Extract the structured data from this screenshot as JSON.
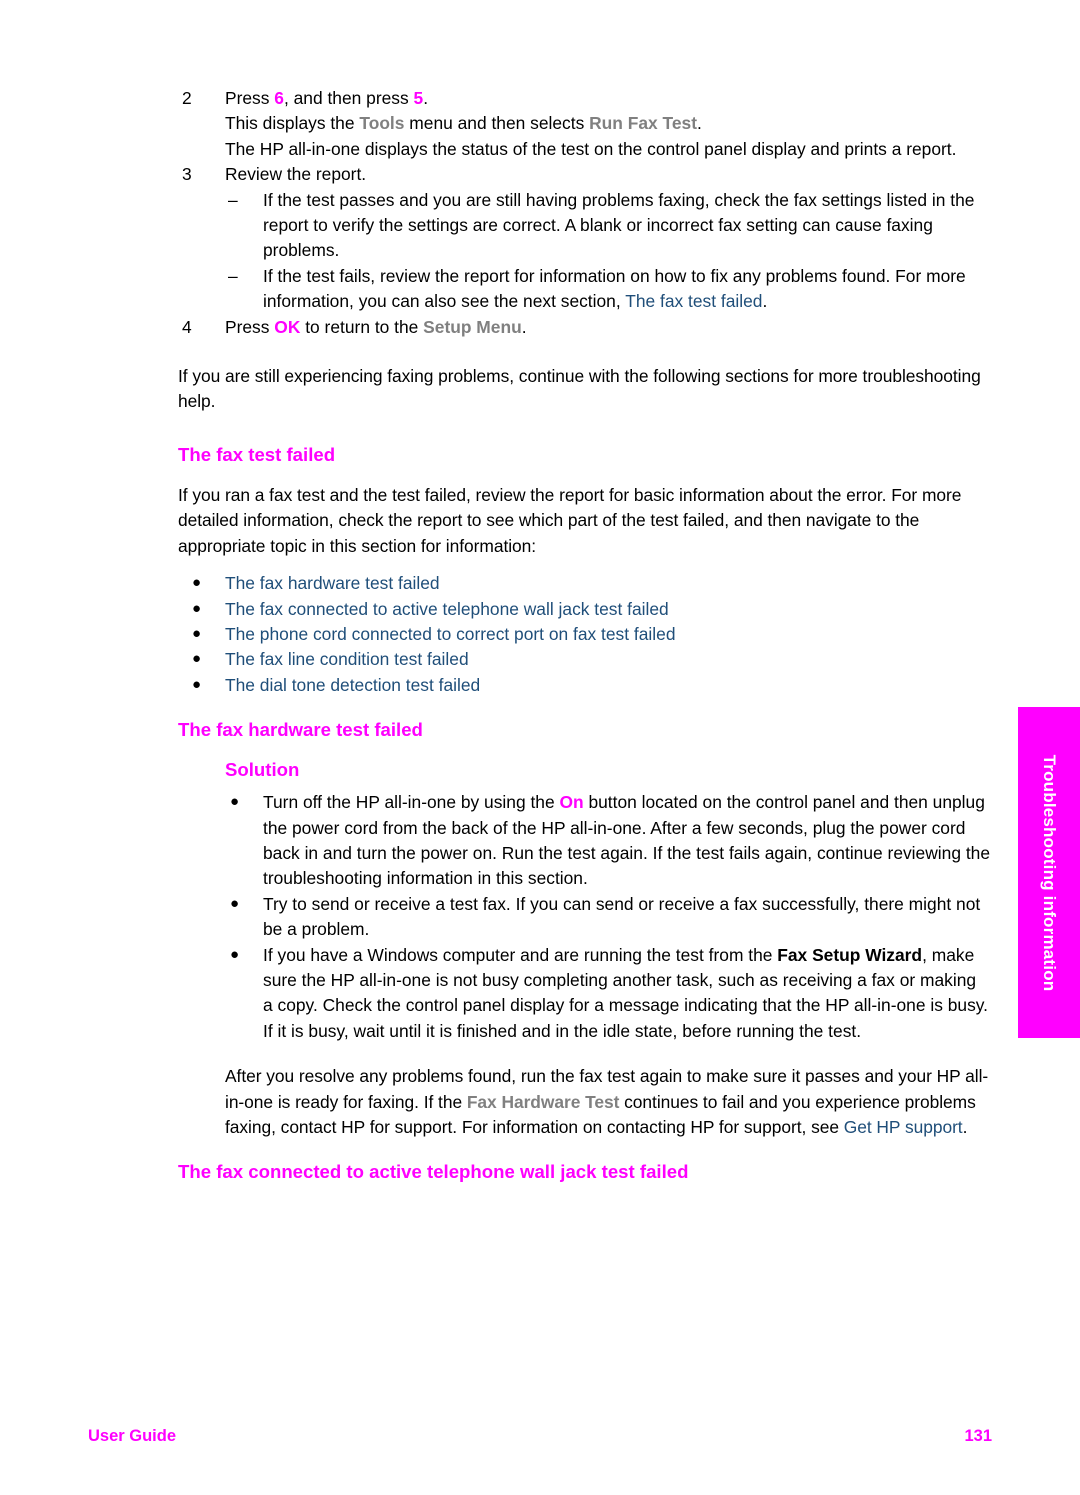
{
  "document": {
    "type": "user-guide-page",
    "colors": {
      "heading_magenta": "#ff00ff",
      "link_navy": "#1f4e79",
      "ui_gray": "#808080",
      "body_black": "#000000",
      "side_tab_bg": "#ff00ff",
      "side_tab_text": "#ffffff"
    }
  },
  "side_tab": {
    "label": "Troubleshooting information"
  },
  "footer": {
    "left": "User Guide",
    "page_number": "131"
  },
  "steps": [
    {
      "number": "2",
      "line1_pre": "Press ",
      "line1_key1": "6",
      "line1_mid": ", and then press ",
      "line1_key2": "5",
      "line1_post": ".",
      "line2_pre": "This displays the ",
      "line2_ui1": "Tools",
      "line2_mid": " menu and then selects ",
      "line2_ui2": "Run Fax Test",
      "line2_post": ".",
      "line3": "The HP all-in-one displays the status of the test on the control panel display and prints a report."
    },
    {
      "number": "3",
      "line1": "Review the report."
    },
    {
      "number": "4",
      "line1_pre": "Press ",
      "line1_key1": "OK",
      "line1_mid": " to return to the ",
      "line1_ui1": "Setup Menu",
      "line1_post": "."
    }
  ],
  "step3_subitems": [
    {
      "dash": "–",
      "text": "If the test passes and you are still having problems faxing, check the fax settings listed in the report to verify the settings are correct. A blank or incorrect fax setting can cause faxing problems."
    },
    {
      "dash": "–",
      "pre": "If the test fails, review the report for information on how to fix any problems found. For more information, you can also see the next section, ",
      "link": "The fax test failed",
      "post": "."
    }
  ],
  "after_steps_para": "If you are still experiencing faxing problems, continue with the following sections for more troubleshooting help.",
  "section_fax_test_failed": {
    "heading": "The fax test failed",
    "intro": "If you ran a fax test and the test failed, review the report for basic information about the error. For more detailed information, check the report to see which part of the test failed, and then navigate to the appropriate topic in this section for information:",
    "links": [
      {
        "bullet": "●",
        "text": "The fax hardware test failed"
      },
      {
        "bullet": "●",
        "text": "The fax connected to active telephone wall jack test failed"
      },
      {
        "bullet": "●",
        "text": "The phone cord connected to correct port on fax test failed"
      },
      {
        "bullet": "●",
        "text": "The fax line condition test failed"
      },
      {
        "bullet": "●",
        "text": "The dial tone detection test failed"
      }
    ]
  },
  "section_fax_hardware_test_failed": {
    "heading": "The fax hardware test failed",
    "solution_label": "Solution",
    "solution_items": [
      {
        "bullet": "●",
        "pre": "Turn off the HP all-in-one by using the ",
        "key": "On",
        "post": " button located on the control panel and then unplug the power cord from the back of the HP all-in-one. After a few seconds, plug the power cord back in and turn the power on. Run the test again. If the test fails again, continue reviewing the troubleshooting information in this section."
      },
      {
        "bullet": "●",
        "text": "Try to send or receive a test fax. If you can send or receive a fax successfully, there might not be a problem."
      },
      {
        "bullet": "●",
        "pre": "If you have a Windows computer and are running the test from the ",
        "bold": "Fax Setup Wizard",
        "post": ", make sure the HP all-in-one is not busy completing another task, such as receiving a fax or making a copy. Check the control panel display for a message indicating that the HP all-in-one is busy. If it is busy, wait until it is finished and in the idle state, before running the test."
      }
    ],
    "closing_pre": "After you resolve any problems found, run the fax test again to make sure it passes and your HP all-in-one is ready for faxing. If the ",
    "closing_ui": "Fax Hardware Test",
    "closing_mid": " continues to fail and you experience problems faxing, contact HP for support. For information on contacting HP for support, see ",
    "closing_link": "Get HP support",
    "closing_post": "."
  },
  "section_wall_jack": {
    "heading": "The fax connected to active telephone wall jack test failed"
  }
}
